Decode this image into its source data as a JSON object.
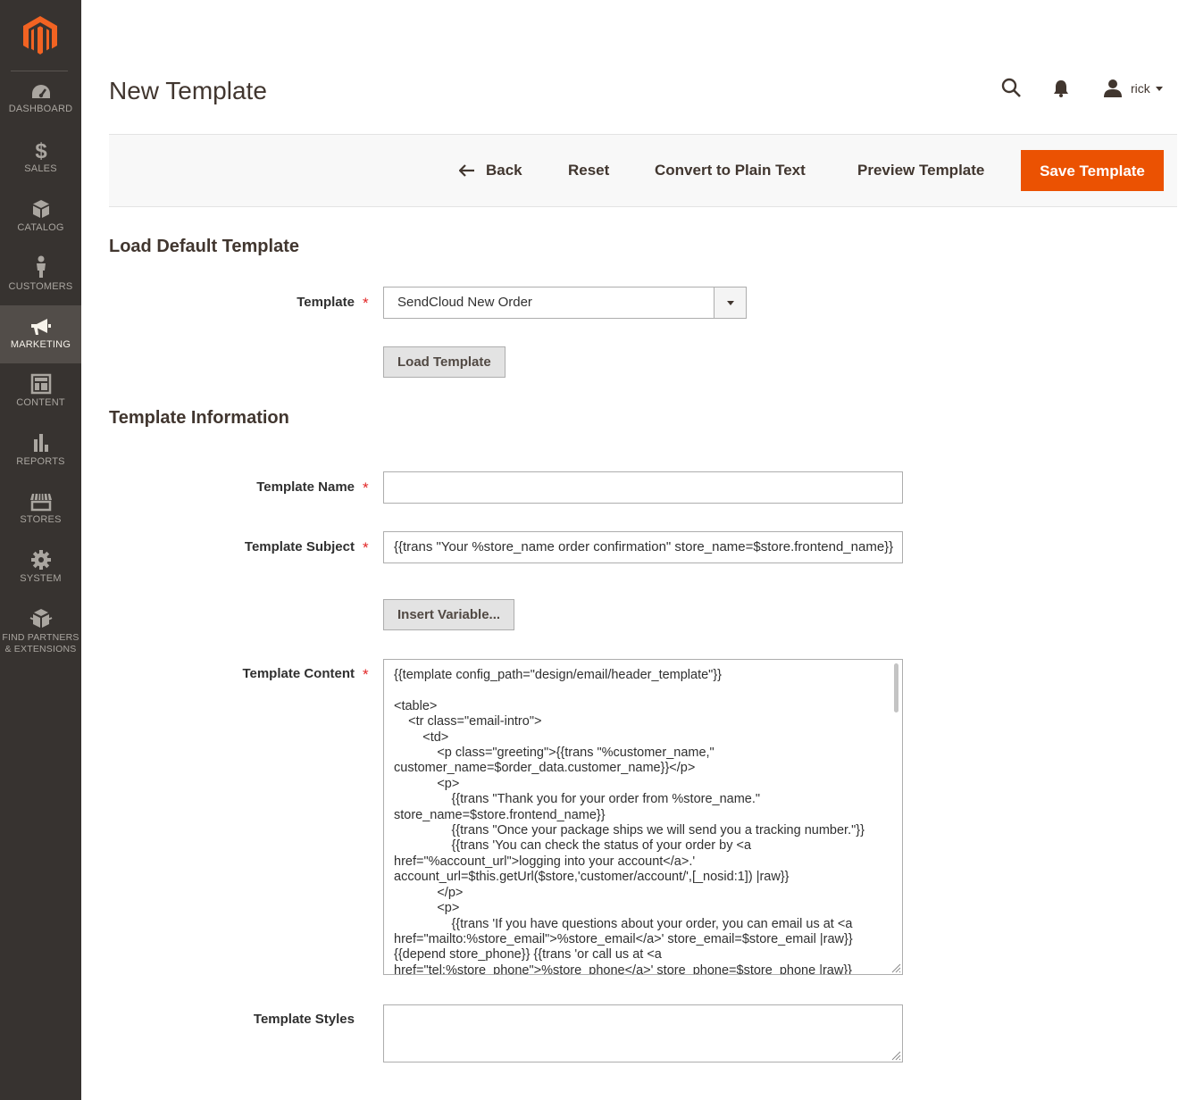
{
  "sidebar": {
    "logo": "magento-logo",
    "items": [
      {
        "label": "DASHBOARD",
        "icon": "dashboard-icon"
      },
      {
        "label": "SALES",
        "icon": "dollar-icon"
      },
      {
        "label": "CATALOG",
        "icon": "box-icon"
      },
      {
        "label": "CUSTOMERS",
        "icon": "person-icon"
      },
      {
        "label": "MARKETING",
        "icon": "megaphone-icon",
        "active": true
      },
      {
        "label": "CONTENT",
        "icon": "layout-icon"
      },
      {
        "label": "REPORTS",
        "icon": "bar-chart-icon"
      },
      {
        "label": "STORES",
        "icon": "storefront-icon"
      },
      {
        "label": "SYSTEM",
        "icon": "gear-icon"
      },
      {
        "label_line1": "FIND PARTNERS",
        "label_line2": "& EXTENSIONS",
        "icon": "cubes-icon"
      }
    ]
  },
  "header": {
    "title": "New Template",
    "user": "rick"
  },
  "action_bar": {
    "back": "Back",
    "reset": "Reset",
    "convert": "Convert to Plain Text",
    "preview": "Preview Template",
    "save": "Save Template"
  },
  "load_section": {
    "title": "Load Default Template",
    "template_label": "Template",
    "template_value": "SendCloud New Order",
    "load_button": "Load Template"
  },
  "info_section": {
    "title": "Template Information",
    "name_label": "Template Name",
    "name_value": "",
    "subject_label": "Template Subject",
    "subject_value": "{{trans \"Your %store_name order confirmation\" store_name=$store.frontend_name}}",
    "insert_variable": "Insert Variable...",
    "content_label": "Template Content",
    "content_value": "{{template config_path=\"design/email/header_template\"}}\n\n<table>\n    <tr class=\"email-intro\">\n        <td>\n            <p class=\"greeting\">{{trans \"%customer_name,\" customer_name=$order_data.customer_name}}</p>\n            <p>\n                {{trans \"Thank you for your order from %store_name.\" store_name=$store.frontend_name}}\n                {{trans \"Once your package ships we will send you a tracking number.\"}}\n                {{trans 'You can check the status of your order by <a href=\"%account_url\">logging into your account</a>.' account_url=$this.getUrl($store,'customer/account/',[_nosid:1]) |raw}}\n            </p>\n            <p>\n                {{trans 'If you have questions about your order, you can email us at <a href=\"mailto:%store_email\">%store_email</a>' store_email=$store_email |raw}}{{depend store_phone}} {{trans 'or call us at <a href=\"tel:%store_phone\">%store_phone</a>' store_phone=$store_phone |raw}}{{/depend}}.",
    "styles_label": "Template Styles",
    "required_mark": "*"
  }
}
